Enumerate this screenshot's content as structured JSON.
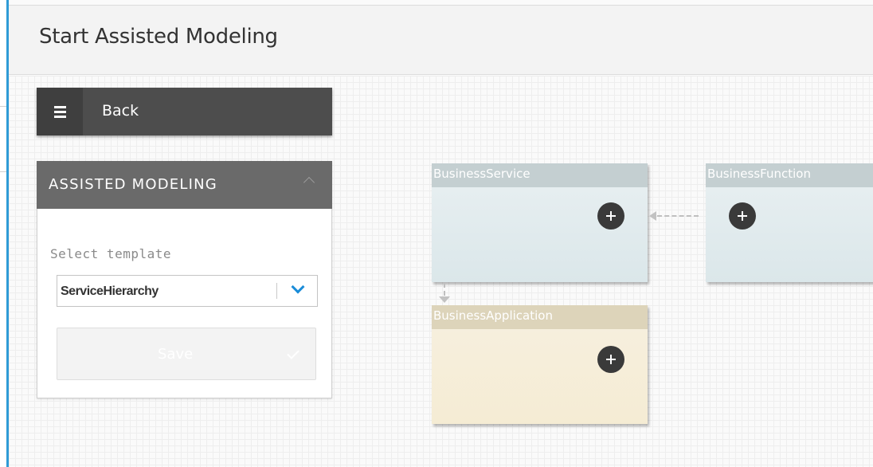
{
  "page": {
    "title": "Start Assisted Modeling"
  },
  "nav": {
    "back_label": "Back"
  },
  "assisted_modeling": {
    "title": "ASSISTED MODELING",
    "select_label": "Select template",
    "template_value": "ServiceHierarchy",
    "save_label": "Save"
  },
  "diagram": {
    "nodes": [
      {
        "label": "BusinessService",
        "color": "#c4cfd1"
      },
      {
        "label": "BusinessFunction",
        "color": "#c4cfd1"
      },
      {
        "label": "BusinessApplication",
        "color": "#ddd4ba"
      }
    ]
  },
  "colors": {
    "accent": "#2f9bd6",
    "select_chevron": "#1a8cd8",
    "dark_header": "#4d4d4d"
  },
  "icons": [
    "hamburger-menu-icon",
    "chevron-up-icon",
    "chevron-down-icon",
    "checkmark-icon",
    "plus-circle-icon"
  ]
}
